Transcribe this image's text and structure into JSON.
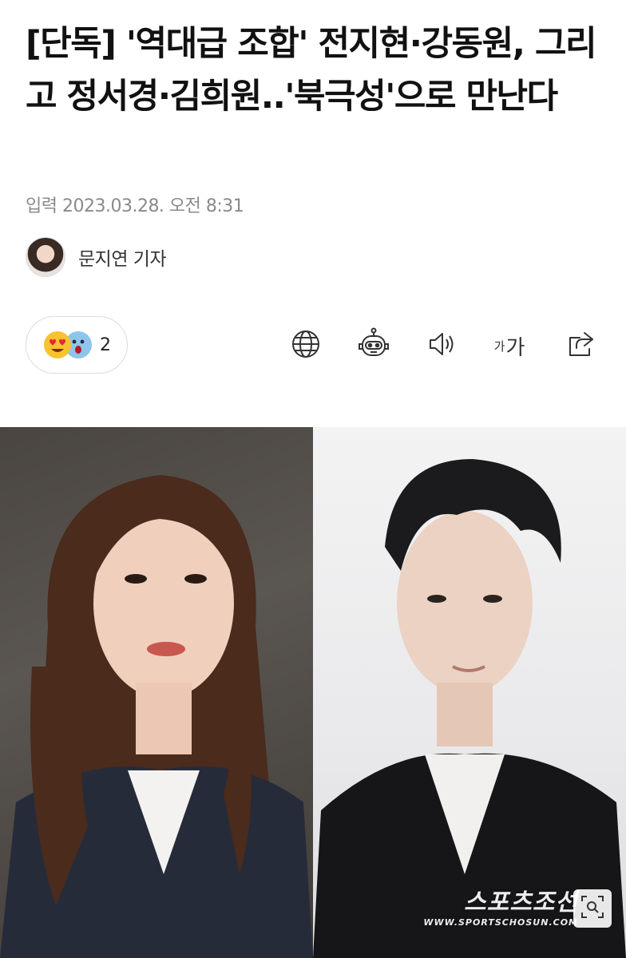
{
  "article": {
    "title": "[단독] '역대급 조합' 전지현·강동원, 그리고 정서경·김희원..'북극성'으로 만난다",
    "dateline": "입력 2023.03.28. 오전 8:31",
    "reporter": "문지연 기자"
  },
  "reactions": {
    "count": "2",
    "emojis": [
      "heart-eyes-emoji",
      "shocked-face-emoji"
    ]
  },
  "toolbar": {
    "icons": [
      "globe-icon",
      "robot-icon",
      "speaker-icon",
      "font-size-icon",
      "share-icon"
    ],
    "font_small": "가",
    "font_large": "가"
  },
  "photo": {
    "watermark_main": "스포츠조선",
    "watermark_sub": "WWW.SPORTSCHOSUN.COM"
  },
  "colors": {
    "title": "#111111",
    "meta": "#8a8a8a",
    "border": "#dcdcdc"
  }
}
